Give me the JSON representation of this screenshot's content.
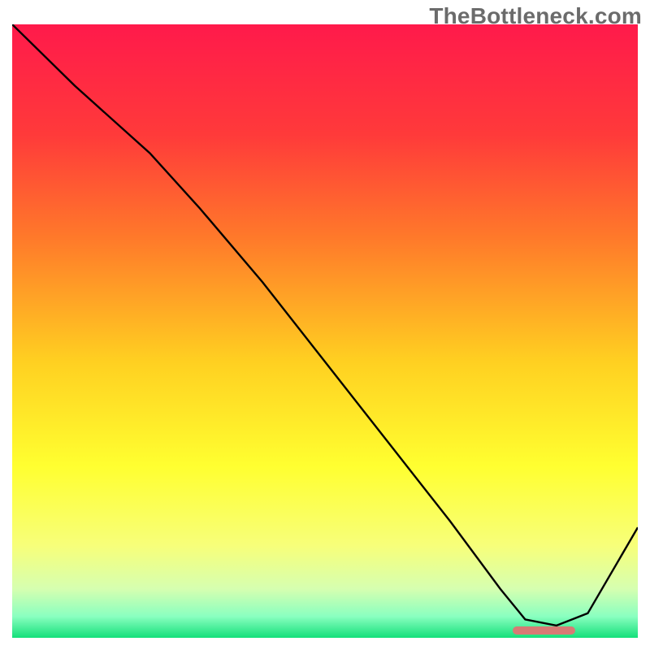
{
  "watermark": "TheBottleneck.com",
  "chart_data": {
    "type": "line",
    "title": "",
    "xlabel": "",
    "ylabel": "",
    "xlim": [
      0,
      100
    ],
    "ylim": [
      0,
      100
    ],
    "x": [
      0,
      10,
      22,
      30,
      40,
      50,
      60,
      70,
      78,
      82,
      87,
      92,
      100
    ],
    "values": [
      100,
      90,
      79,
      70,
      58,
      45,
      32,
      19,
      8,
      3,
      2,
      4,
      18
    ],
    "highlight_range_x": [
      80,
      90
    ],
    "gradient_stops": [
      {
        "pos": 0.0,
        "color": "#ff1a4b"
      },
      {
        "pos": 0.18,
        "color": "#ff3a3a"
      },
      {
        "pos": 0.35,
        "color": "#ff7a2a"
      },
      {
        "pos": 0.55,
        "color": "#ffd021"
      },
      {
        "pos": 0.72,
        "color": "#ffff30"
      },
      {
        "pos": 0.85,
        "color": "#f7ff7a"
      },
      {
        "pos": 0.92,
        "color": "#d6ffb0"
      },
      {
        "pos": 0.965,
        "color": "#8affc0"
      },
      {
        "pos": 1.0,
        "color": "#14e07a"
      }
    ],
    "highlight_color": "#d77a74",
    "line_color": "#000000",
    "line_width": 2.4
  }
}
